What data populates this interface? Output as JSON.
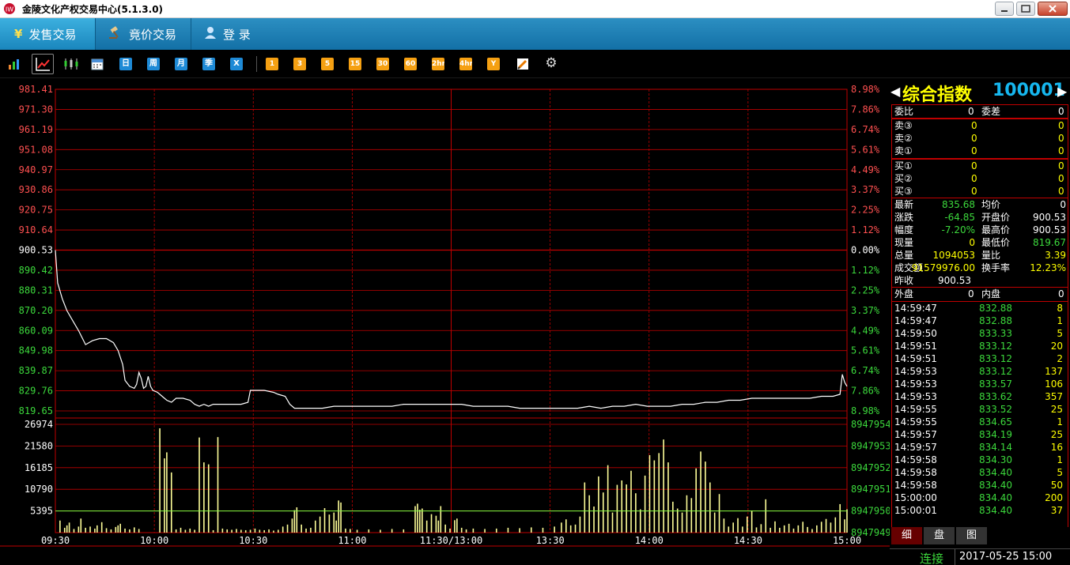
{
  "window": {
    "title": "金陵文化产权交易中心(5.1.3.0)"
  },
  "menu": {
    "items": [
      {
        "label": "发售交易",
        "icon": "yen-icon",
        "active": true
      },
      {
        "label": "竟价交易",
        "icon": "gavel-icon",
        "active": false
      },
      {
        "label": "登  录",
        "icon": "user-icon",
        "active": false
      }
    ]
  },
  "toolbar": {
    "period_buttons": [
      "日",
      "周",
      "月",
      "季",
      "X"
    ],
    "minute_buttons": [
      "1",
      "3",
      "5",
      "15",
      "30",
      "60",
      "2hr",
      "4hr",
      "Y"
    ],
    "icons": [
      "bar-chart-icon",
      "line-chart-icon",
      "candlestick-icon",
      "calendar-icon",
      "draw-tool-icon",
      "settings-gear-icon"
    ]
  },
  "chart_data": {
    "type": "line",
    "price_ticks_left": [
      "981.41",
      "971.30",
      "961.19",
      "951.08",
      "940.97",
      "930.86",
      "920.75",
      "910.64",
      "900.53",
      "890.42",
      "880.31",
      "870.20",
      "860.09",
      "849.98",
      "839.87",
      "829.76",
      "819.65"
    ],
    "pct_ticks_right": [
      "8.98%",
      "7.86%",
      "6.74%",
      "5.61%",
      "4.49%",
      "3.37%",
      "2.25%",
      "1.12%",
      "0.00%",
      "1.12%",
      "2.25%",
      "3.37%",
      "4.49%",
      "5.61%",
      "6.74%",
      "7.86%",
      "8.98%"
    ],
    "volume_ticks_left": [
      "26974",
      "21580",
      "16185",
      "10790",
      "5395"
    ],
    "volume_ticks_right": [
      "8947954",
      "8947953",
      "8947952",
      "8947951",
      "8947950",
      "8947949"
    ],
    "time_labels": [
      "09:30",
      "10:00",
      "10:30",
      "11:00",
      "11:30/13:00",
      "13:30",
      "14:00",
      "14:30",
      "15:00"
    ],
    "ylim": [
      819.65,
      981.41
    ],
    "prev_close": 900.53,
    "volume_reference": 5395,
    "price_series": [
      [
        0,
        900.53
      ],
      [
        1,
        884
      ],
      [
        3,
        876
      ],
      [
        5,
        870
      ],
      [
        8,
        864
      ],
      [
        10,
        860
      ],
      [
        13,
        853
      ],
      [
        16,
        855
      ],
      [
        19,
        856
      ],
      [
        22,
        856
      ],
      [
        25,
        854
      ],
      [
        27,
        850
      ],
      [
        29,
        843
      ],
      [
        30,
        835
      ],
      [
        32,
        832
      ],
      [
        34,
        831
      ],
      [
        35,
        833
      ],
      [
        36,
        839
      ],
      [
        37,
        836
      ],
      [
        38,
        831
      ],
      [
        39,
        832
      ],
      [
        40,
        837
      ],
      [
        41,
        832
      ],
      [
        42,
        830
      ],
      [
        44,
        829
      ],
      [
        46,
        827
      ],
      [
        48,
        825
      ],
      [
        50,
        824
      ],
      [
        52,
        826
      ],
      [
        55,
        826
      ],
      [
        58,
        825
      ],
      [
        60,
        823
      ],
      [
        62,
        822
      ],
      [
        64,
        823
      ],
      [
        66,
        822
      ],
      [
        68,
        823
      ],
      [
        72,
        823
      ],
      [
        76,
        823
      ],
      [
        80,
        823
      ],
      [
        83,
        824
      ],
      [
        84,
        830
      ],
      [
        86,
        830
      ],
      [
        90,
        830
      ],
      [
        94,
        829
      ],
      [
        96,
        828
      ],
      [
        99,
        827
      ],
      [
        101,
        823
      ],
      [
        103,
        821
      ],
      [
        106,
        821
      ],
      [
        110,
        821
      ],
      [
        115,
        821
      ],
      [
        120,
        822
      ],
      [
        125,
        822
      ],
      [
        130,
        822
      ],
      [
        135,
        822
      ],
      [
        140,
        822
      ],
      [
        145,
        822
      ],
      [
        150,
        823
      ],
      [
        155,
        823
      ],
      [
        160,
        823
      ],
      [
        165,
        823
      ],
      [
        170,
        823
      ],
      [
        175,
        823
      ],
      [
        180,
        822
      ],
      [
        185,
        822
      ],
      [
        190,
        822
      ],
      [
        195,
        822
      ],
      [
        200,
        821
      ],
      [
        205,
        821
      ],
      [
        210,
        821
      ],
      [
        215,
        821
      ],
      [
        220,
        821
      ],
      [
        225,
        821
      ],
      [
        230,
        822
      ],
      [
        235,
        821
      ],
      [
        240,
        822
      ],
      [
        245,
        822
      ],
      [
        250,
        823
      ],
      [
        255,
        822
      ],
      [
        260,
        822
      ],
      [
        265,
        822
      ],
      [
        270,
        823
      ],
      [
        275,
        823
      ],
      [
        280,
        824
      ],
      [
        285,
        824
      ],
      [
        290,
        825
      ],
      [
        295,
        825
      ],
      [
        300,
        826
      ],
      [
        305,
        826
      ],
      [
        310,
        826
      ],
      [
        315,
        826
      ],
      [
        320,
        826
      ],
      [
        325,
        826
      ],
      [
        330,
        827
      ],
      [
        335,
        827
      ],
      [
        338,
        828
      ],
      [
        339,
        838
      ],
      [
        340,
        834
      ],
      [
        341,
        832
      ]
    ],
    "volume_bars": [
      [
        2,
        3000
      ],
      [
        4,
        1200
      ],
      [
        5,
        1800
      ],
      [
        6,
        2500
      ],
      [
        8,
        900
      ],
      [
        10,
        1500
      ],
      [
        11,
        3500
      ],
      [
        13,
        1200
      ],
      [
        15,
        1500
      ],
      [
        17,
        1000
      ],
      [
        18,
        1800
      ],
      [
        20,
        2600
      ],
      [
        22,
        1100
      ],
      [
        24,
        800
      ],
      [
        26,
        1400
      ],
      [
        27,
        1800
      ],
      [
        28,
        2200
      ],
      [
        30,
        1000
      ],
      [
        32,
        800
      ],
      [
        34,
        1300
      ],
      [
        36,
        900
      ],
      [
        45,
        26000
      ],
      [
        47,
        18500
      ],
      [
        48,
        20000
      ],
      [
        50,
        15000
      ],
      [
        52,
        800
      ],
      [
        54,
        1200
      ],
      [
        56,
        700
      ],
      [
        58,
        1000
      ],
      [
        60,
        700
      ],
      [
        62,
        23700
      ],
      [
        64,
        17500
      ],
      [
        66,
        17000
      ],
      [
        68,
        600
      ],
      [
        70,
        23800
      ],
      [
        72,
        1000
      ],
      [
        74,
        800
      ],
      [
        76,
        700
      ],
      [
        78,
        900
      ],
      [
        80,
        700
      ],
      [
        82,
        600
      ],
      [
        84,
        700
      ],
      [
        86,
        1000
      ],
      [
        88,
        700
      ],
      [
        90,
        600
      ],
      [
        92,
        800
      ],
      [
        94,
        500
      ],
      [
        96,
        700
      ],
      [
        98,
        1500
      ],
      [
        100,
        2000
      ],
      [
        102,
        3500
      ],
      [
        103,
        5600
      ],
      [
        104,
        6300
      ],
      [
        106,
        2000
      ],
      [
        108,
        1000
      ],
      [
        110,
        1200
      ],
      [
        112,
        3000
      ],
      [
        114,
        4000
      ],
      [
        116,
        6100
      ],
      [
        118,
        4500
      ],
      [
        120,
        5000
      ],
      [
        121,
        3000
      ],
      [
        122,
        8000
      ],
      [
        123,
        7500
      ],
      [
        125,
        1000
      ],
      [
        127,
        900
      ],
      [
        130,
        700
      ],
      [
        135,
        800
      ],
      [
        140,
        700
      ],
      [
        145,
        900
      ],
      [
        150,
        800
      ],
      [
        155,
        6600
      ],
      [
        156,
        7200
      ],
      [
        157,
        5700
      ],
      [
        158,
        6000
      ],
      [
        160,
        3000
      ],
      [
        162,
        4600
      ],
      [
        164,
        4200
      ],
      [
        165,
        3000
      ],
      [
        166,
        6600
      ],
      [
        168,
        2000
      ],
      [
        170,
        1000
      ],
      [
        172,
        3100
      ],
      [
        173,
        3500
      ],
      [
        175,
        1200
      ],
      [
        177,
        800
      ],
      [
        180,
        1000
      ],
      [
        185,
        900
      ],
      [
        190,
        1000
      ],
      [
        195,
        1200
      ],
      [
        200,
        1100
      ],
      [
        205,
        1300
      ],
      [
        210,
        1200
      ],
      [
        215,
        1500
      ],
      [
        218,
        2500
      ],
      [
        220,
        3300
      ],
      [
        222,
        1800
      ],
      [
        224,
        2000
      ],
      [
        226,
        4000
      ],
      [
        228,
        12500
      ],
      [
        230,
        9300
      ],
      [
        232,
        6500
      ],
      [
        234,
        14000
      ],
      [
        236,
        10000
      ],
      [
        238,
        16800
      ],
      [
        240,
        5000
      ],
      [
        242,
        11900
      ],
      [
        244,
        13000
      ],
      [
        246,
        12000
      ],
      [
        248,
        15400
      ],
      [
        250,
        9800
      ],
      [
        252,
        5800
      ],
      [
        254,
        14200
      ],
      [
        256,
        19300
      ],
      [
        258,
        18000
      ],
      [
        260,
        19800
      ],
      [
        262,
        23200
      ],
      [
        264,
        17500
      ],
      [
        266,
        7700
      ],
      [
        268,
        6000
      ],
      [
        270,
        5000
      ],
      [
        272,
        9300
      ],
      [
        274,
        8600
      ],
      [
        276,
        16000
      ],
      [
        278,
        20200
      ],
      [
        280,
        17700
      ],
      [
        282,
        12500
      ],
      [
        284,
        5000
      ],
      [
        286,
        9600
      ],
      [
        288,
        3500
      ],
      [
        290,
        1500
      ],
      [
        292,
        2500
      ],
      [
        294,
        3600
      ],
      [
        296,
        1500
      ],
      [
        298,
        4000
      ],
      [
        300,
        5500
      ],
      [
        302,
        1300
      ],
      [
        304,
        2100
      ],
      [
        306,
        8300
      ],
      [
        308,
        1200
      ],
      [
        310,
        2800
      ],
      [
        312,
        1200
      ],
      [
        314,
        1800
      ],
      [
        316,
        2200
      ],
      [
        318,
        1000
      ],
      [
        320,
        1800
      ],
      [
        322,
        2700
      ],
      [
        324,
        1400
      ],
      [
        326,
        900
      ],
      [
        328,
        1800
      ],
      [
        330,
        2700
      ],
      [
        332,
        3400
      ],
      [
        334,
        2500
      ],
      [
        336,
        3800
      ],
      [
        338,
        7100
      ],
      [
        340,
        3300
      ],
      [
        341,
        5800
      ]
    ]
  },
  "panel": {
    "title_name": "综合指数",
    "title_code": "100001",
    "weibi": {
      "label": "委比",
      "value": "0",
      "label2": "委差",
      "value2": "0"
    },
    "sells": [
      {
        "label": "卖③",
        "price": "0",
        "vol": "0"
      },
      {
        "label": "卖②",
        "price": "0",
        "vol": "0"
      },
      {
        "label": "卖①",
        "price": "0",
        "vol": "0"
      }
    ],
    "buys": [
      {
        "label": "买①",
        "price": "0",
        "vol": "0"
      },
      {
        "label": "买②",
        "price": "0",
        "vol": "0"
      },
      {
        "label": "买③",
        "price": "0",
        "vol": "0"
      }
    ],
    "quote": [
      {
        "l1": "最新",
        "v1": "835.68",
        "c1": "grn",
        "l2": "均价",
        "v2": "0",
        "c2": "wht"
      },
      {
        "l1": "涨跌",
        "v1": "-64.85",
        "c1": "grn",
        "l2": "开盘价",
        "v2": "900.53",
        "c2": "wht"
      },
      {
        "l1": "幅度",
        "v1": "-7.20%",
        "c1": "grn",
        "l2": "最高价",
        "v2": "900.53",
        "c2": "wht"
      },
      {
        "l1": "现量",
        "v1": "0",
        "c1": "yel",
        "l2": "最低价",
        "v2": "819.67",
        "c2": "grn"
      },
      {
        "l1": "总量",
        "v1": "1094053",
        "c1": "yel",
        "l2": "量比",
        "v2": "3.39",
        "c2": "yel"
      },
      {
        "l1": "成交额",
        "v1": "91579976.00",
        "c1": "yel",
        "l2": "换手率",
        "v2": "12.23%",
        "c2": "yel"
      }
    ],
    "prev_close": {
      "label": "昨收",
      "value": "900.53"
    },
    "waipan": {
      "label": "外盘",
      "value": "0",
      "label2": "内盘",
      "value2": "0"
    },
    "ticks": [
      {
        "time": "14:59:47",
        "price": "832.88",
        "vol": "8"
      },
      {
        "time": "14:59:47",
        "price": "832.88",
        "vol": "1"
      },
      {
        "time": "14:59:50",
        "price": "833.33",
        "vol": "5"
      },
      {
        "time": "14:59:51",
        "price": "833.12",
        "vol": "20"
      },
      {
        "time": "14:59:51",
        "price": "833.12",
        "vol": "2"
      },
      {
        "time": "14:59:53",
        "price": "833.12",
        "vol": "137"
      },
      {
        "time": "14:59:53",
        "price": "833.57",
        "vol": "106"
      },
      {
        "time": "14:59:53",
        "price": "833.62",
        "vol": "357"
      },
      {
        "time": "14:59:55",
        "price": "833.52",
        "vol": "25"
      },
      {
        "time": "14:59:55",
        "price": "834.65",
        "vol": "1"
      },
      {
        "time": "14:59:57",
        "price": "834.19",
        "vol": "25"
      },
      {
        "time": "14:59:57",
        "price": "834.14",
        "vol": "16"
      },
      {
        "time": "14:59:58",
        "price": "834.30",
        "vol": "1"
      },
      {
        "time": "14:59:58",
        "price": "834.40",
        "vol": "5"
      },
      {
        "time": "14:59:58",
        "price": "834.40",
        "vol": "50"
      },
      {
        "time": "15:00:00",
        "price": "834.40",
        "vol": "200"
      },
      {
        "time": "15:00:01",
        "price": "834.40",
        "vol": "37"
      }
    ],
    "tabs": [
      "细",
      "盘",
      "图"
    ]
  },
  "status": {
    "connection": "连接",
    "datetime": "2017-05-25 15:00"
  },
  "colors": {
    "grid_red": "#c00000",
    "grid_dash": "#a00000",
    "up_red": "#ff5050",
    "down_green": "#3cd93c",
    "price_line": "#ffffff",
    "volume_bar": "#ffff99",
    "accent_cyan": "#16b7ef",
    "title_yellow": "#ffff00"
  }
}
